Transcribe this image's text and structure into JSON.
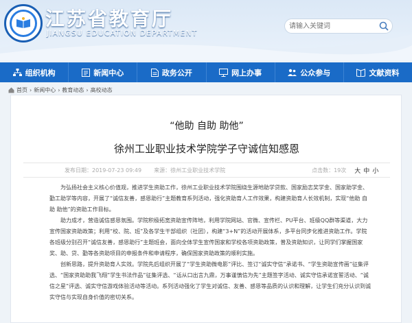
{
  "header": {
    "title": "江苏省教育厅",
    "subtitle": "JIANGSU EDUCATION DEPARTMENT",
    "search_placeholder": "请输入关键词"
  },
  "nav": [
    {
      "label": "组织机构",
      "icon": "org-chart-icon"
    },
    {
      "label": "新闻中心",
      "icon": "news-icon"
    },
    {
      "label": "政务公开",
      "icon": "document-icon"
    },
    {
      "label": "网上办事",
      "icon": "monitor-icon"
    },
    {
      "label": "公众参与",
      "icon": "people-icon"
    },
    {
      "label": "文献资料",
      "icon": "book-icon"
    }
  ],
  "breadcrumb": [
    "首页",
    "新闻中心",
    "教育动态",
    "高校动态"
  ],
  "article": {
    "title1": "“他助 自助 助他”",
    "title2": "徐州工业职业技术学院学子守诚信知感恩",
    "published": "发布日期：2019-07-23 09:49",
    "source": "来源：徐州工业职业技术学院",
    "views": "点击数：19次",
    "font_sizes": [
      "大",
      "中",
      "小"
    ],
    "paragraphs": [
      "为弘扬社会主义核心价值观，推进学生资助工作，徐州工业职业技术学院围绕生源地助学贷款、国家励志奖学金、国家助学金、勤工助学等内容，开展了“诚信友善，感恩助行”主题教育系列活动，强化资助育人工作效果，构建资助育人长效机制，实现“他助 自助 助他”的资助工作目标。",
      "助力成才，营造诚信感恩氛围。学院积极拓宽资助宣传阵地，利用学院网站、官微、宣传栏、PU平台、班级QQ群等渠道，大力宣传国家资助政策；利用“校、院、班”及各学生干部组织（社团），构建“3+N”的活动开展体系，多平台同步化推进资助工作。学院各班级分别召开“诚信友善，感恩助行”主题班会，面向全体学生宣传国家和学校各项资助政策，普及资助知识，让同学们掌握国家奖、助、贷、勤等各资助项目的申报条件和申请程序，确保国家资助政策的顺利实施。",
      "创新思路，提升资助育人实效。学院先后组织开展了“学生资助微电影”评比、签订“诚实守信”承诺书、“学生资助宣传画”征集评选、“国家资助助我飞翔”学生书法作品”征集评选、“话从口出言九鼎，万事谨慎信为先”主题签字活动、诚实守信承诺宣誓活动、“诚信之星”评选、诚实守信游戏体验活动等活动。系列活动强化了学生对诚信、友善、感恩等品质的认识和理解，让学生们充分认识到诚实守信与实现自身价值的密切关系。"
    ]
  },
  "colors": {
    "nav_bg": "#1a6bc7",
    "header_bg": "#dbe8f6",
    "page_bg": "#eef3f8"
  }
}
